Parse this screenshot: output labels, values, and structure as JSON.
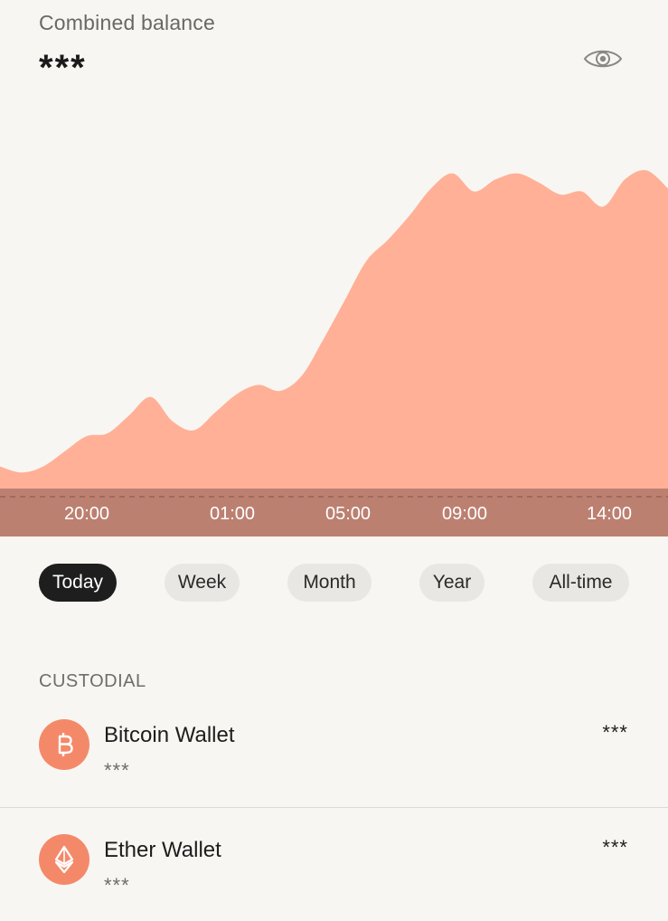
{
  "header": {
    "title": "Combined balance",
    "balance": "***",
    "visibility_icon": "eye-icon"
  },
  "chart_data": {
    "type": "area",
    "x_labels": [
      "20:00",
      "01:00",
      "05:00",
      "09:00",
      "14:00"
    ],
    "series": [
      {
        "points": [
          0.1,
          0.08,
          0.1,
          0.15,
          0.2,
          0.21,
          0.27,
          0.33,
          0.25,
          0.22,
          0.28,
          0.34,
          0.37,
          0.35,
          0.4,
          0.52,
          0.65,
          0.78,
          0.85,
          0.93,
          1.02,
          1.07,
          1.01,
          1.05,
          1.07,
          1.04,
          1.0,
          1.01,
          0.96,
          1.05,
          1.08,
          1.02
        ]
      }
    ],
    "baseline": 0.0,
    "colors": {
      "area": "#ffb097",
      "band": "#b87d6f",
      "dash": "#8f5d52",
      "labels": "#ffffff"
    }
  },
  "ranges": [
    {
      "label": "Today",
      "active": true
    },
    {
      "label": "Week",
      "active": false
    },
    {
      "label": "Month",
      "active": false
    },
    {
      "label": "Year",
      "active": false
    },
    {
      "label": "All-time",
      "active": false
    }
  ],
  "custodial": {
    "label": "CUSTODIAL",
    "wallets": [
      {
        "name": "Bitcoin Wallet",
        "sub": "***",
        "amount": "***",
        "icon": "bitcoin-icon"
      },
      {
        "name": "Ether Wallet",
        "sub": "***",
        "amount": "***",
        "icon": "ether-icon"
      }
    ]
  }
}
